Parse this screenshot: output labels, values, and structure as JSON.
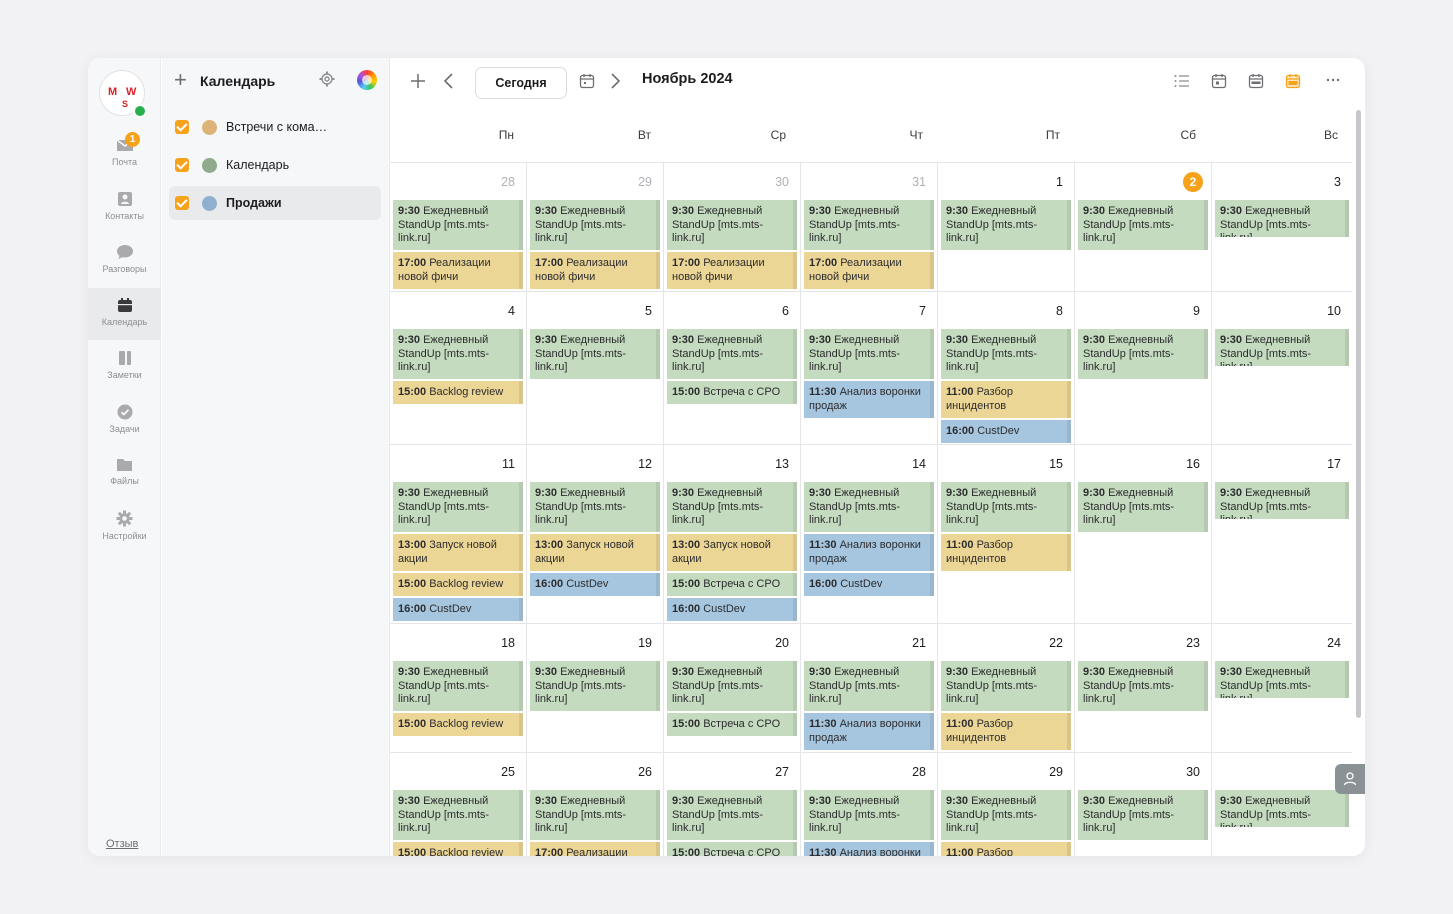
{
  "rail": {
    "avatar_letters": [
      "M",
      "W",
      "S"
    ],
    "mail_badge": "1",
    "items": [
      {
        "label": "Почта",
        "icon": "mail-icon"
      },
      {
        "label": "Контакты",
        "icon": "contacts-icon"
      },
      {
        "label": "Разговоры",
        "icon": "chat-icon"
      },
      {
        "label": "Календарь",
        "icon": "calendar-icon"
      },
      {
        "label": "Заметки",
        "icon": "notes-icon"
      },
      {
        "label": "Задачи",
        "icon": "tasks-icon"
      },
      {
        "label": "Файлы",
        "icon": "folder-icon"
      },
      {
        "label": "Настройки",
        "icon": "settings-icon"
      }
    ],
    "feedback": "Отзыв"
  },
  "panel": {
    "title": "Календарь",
    "calendars": [
      {
        "name": "Встречи с кома…",
        "color": "#dcb47a"
      },
      {
        "name": "Календарь",
        "color": "#8fab8c"
      },
      {
        "name": "Продажи",
        "color": "#8fb1cf"
      }
    ]
  },
  "toolbar": {
    "today_label": "Сегодня",
    "month_title": "Ноябрь 2024",
    "view_icons": [
      "list-view-icon",
      "day-view-icon",
      "week-view-icon",
      "month-view-icon",
      "more-icon"
    ]
  },
  "weekdays": [
    "Пн",
    "Вт",
    "Ср",
    "Чт",
    "Пт",
    "Сб",
    "Вс"
  ],
  "colors": {
    "accent": "#f7a21b",
    "green_event": "#c4dbbf",
    "yellow_event": "#ecd696",
    "blue_event": "#a6c6df"
  },
  "weeks": [
    {
      "days": [
        {
          "num": "28",
          "muted": true,
          "events": [
            [
              "9:30",
              "Ежедневный StandUp [mts.mts-link.ru]",
              "green"
            ],
            [
              "17:00",
              "Реализации новой фичи",
              "yellow"
            ]
          ]
        },
        {
          "num": "29",
          "muted": true,
          "events": [
            [
              "9:30",
              "Ежедневный StandUp [mts.mts-link.ru]",
              "green"
            ],
            [
              "17:00",
              "Реализации новой фичи",
              "yellow"
            ]
          ]
        },
        {
          "num": "30",
          "muted": true,
          "events": [
            [
              "9:30",
              "Ежедневный StandUp [mts.mts-link.ru]",
              "green"
            ],
            [
              "17:00",
              "Реализации новой фичи",
              "yellow"
            ]
          ]
        },
        {
          "num": "31",
          "muted": true,
          "events": [
            [
              "9:30",
              "Ежедневный StandUp [mts.mts-link.ru]",
              "green"
            ],
            [
              "17:00",
              "Реализации новой фичи",
              "yellow"
            ]
          ]
        },
        {
          "num": "1",
          "events": [
            [
              "9:30",
              "Ежедневный StandUp [mts.mts-link.ru]",
              "green"
            ]
          ]
        },
        {
          "num": "2",
          "today": true,
          "events": [
            [
              "9:30",
              "Ежедневный StandUp [mts.mts-link.ru]",
              "green"
            ]
          ]
        },
        {
          "num": "3",
          "events": [
            [
              "9:30",
              "Ежедневный StandUp [mts.mts-link.ru]",
              "green"
            ]
          ]
        }
      ]
    },
    {
      "days": [
        {
          "num": "4",
          "events": [
            [
              "9:30",
              "Ежедневный StandUp [mts.mts-link.ru]",
              "green"
            ],
            [
              "15:00",
              "Backlog review",
              "yellow"
            ]
          ]
        },
        {
          "num": "5",
          "events": [
            [
              "9:30",
              "Ежедневный StandUp [mts.mts-link.ru]",
              "green"
            ]
          ]
        },
        {
          "num": "6",
          "events": [
            [
              "9:30",
              "Ежедневный StandUp [mts.mts-link.ru]",
              "green"
            ],
            [
              "15:00",
              "Встреча с CPO",
              "green"
            ]
          ]
        },
        {
          "num": "7",
          "events": [
            [
              "9:30",
              "Ежедневный StandUp [mts.mts-link.ru]",
              "green"
            ],
            [
              "11:30",
              "Анализ воронки продаж",
              "blue"
            ]
          ]
        },
        {
          "num": "8",
          "events": [
            [
              "9:30",
              "Ежедневный StandUp [mts.mts-link.ru]",
              "green"
            ],
            [
              "11:00",
              "Разбор инцидентов",
              "yellow"
            ],
            [
              "16:00",
              "CustDev",
              "blue"
            ]
          ]
        },
        {
          "num": "9",
          "events": [
            [
              "9:30",
              "Ежедневный StandUp [mts.mts-link.ru]",
              "green"
            ]
          ]
        },
        {
          "num": "10",
          "events": [
            [
              "9:30",
              "Ежедневный StandUp [mts.mts-link.ru]",
              "green"
            ]
          ]
        }
      ]
    },
    {
      "days": [
        {
          "num": "11",
          "events": [
            [
              "9:30",
              "Ежедневный StandUp [mts.mts-link.ru]",
              "green"
            ],
            [
              "13:00",
              "Запуск новой акции",
              "yellow"
            ],
            [
              "15:00",
              "Backlog review",
              "yellow"
            ],
            [
              "16:00",
              "CustDev",
              "blue"
            ]
          ]
        },
        {
          "num": "12",
          "events": [
            [
              "9:30",
              "Ежедневный StandUp [mts.mts-link.ru]",
              "green"
            ],
            [
              "13:00",
              "Запуск новой акции",
              "yellow"
            ],
            [
              "16:00",
              "CustDev",
              "blue"
            ]
          ]
        },
        {
          "num": "13",
          "events": [
            [
              "9:30",
              "Ежедневный StandUp [mts.mts-link.ru]",
              "green"
            ],
            [
              "13:00",
              "Запуск новой акции",
              "yellow"
            ],
            [
              "15:00",
              "Встреча с CPO",
              "green"
            ],
            [
              "16:00",
              "CustDev",
              "blue"
            ]
          ]
        },
        {
          "num": "14",
          "events": [
            [
              "9:30",
              "Ежедневный StandUp [mts.mts-link.ru]",
              "green"
            ],
            [
              "11:30",
              "Анализ воронки продаж",
              "blue"
            ],
            [
              "16:00",
              "CustDev",
              "blue"
            ]
          ]
        },
        {
          "num": "15",
          "events": [
            [
              "9:30",
              "Ежедневный StandUp [mts.mts-link.ru]",
              "green"
            ],
            [
              "11:00",
              "Разбор инцидентов",
              "yellow"
            ]
          ]
        },
        {
          "num": "16",
          "events": [
            [
              "9:30",
              "Ежедневный StandUp [mts.mts-link.ru]",
              "green"
            ]
          ]
        },
        {
          "num": "17",
          "events": [
            [
              "9:30",
              "Ежедневный StandUp [mts.mts-link.ru]",
              "green"
            ]
          ]
        }
      ]
    },
    {
      "days": [
        {
          "num": "18",
          "events": [
            [
              "9:30",
              "Ежедневный StandUp [mts.mts-link.ru]",
              "green"
            ],
            [
              "15:00",
              "Backlog review",
              "yellow"
            ]
          ]
        },
        {
          "num": "19",
          "events": [
            [
              "9:30",
              "Ежедневный StandUp [mts.mts-link.ru]",
              "green"
            ]
          ]
        },
        {
          "num": "20",
          "events": [
            [
              "9:30",
              "Ежедневный StandUp [mts.mts-link.ru]",
              "green"
            ],
            [
              "15:00",
              "Встреча с CPO",
              "green"
            ]
          ]
        },
        {
          "num": "21",
          "events": [
            [
              "9:30",
              "Ежедневный StandUp [mts.mts-link.ru]",
              "green"
            ],
            [
              "11:30",
              "Анализ воронки продаж",
              "blue"
            ]
          ]
        },
        {
          "num": "22",
          "events": [
            [
              "9:30",
              "Ежедневный StandUp [mts.mts-link.ru]",
              "green"
            ],
            [
              "11:00",
              "Разбор инцидентов",
              "yellow"
            ]
          ]
        },
        {
          "num": "23",
          "events": [
            [
              "9:30",
              "Ежедневный StandUp [mts.mts-link.ru]",
              "green"
            ]
          ]
        },
        {
          "num": "24",
          "events": [
            [
              "9:30",
              "Ежедневный StandUp [mts.mts-link.ru]",
              "green"
            ]
          ]
        }
      ]
    },
    {
      "days": [
        {
          "num": "25",
          "events": [
            [
              "9:30",
              "Ежедневный StandUp [mts.mts-link.ru]",
              "green"
            ],
            [
              "15:00",
              "Backlog review",
              "yellow"
            ]
          ]
        },
        {
          "num": "26",
          "events": [
            [
              "9:30",
              "Ежедневный StandUp [mts.mts-link.ru]",
              "green"
            ],
            [
              "17:00",
              "Реализации",
              "yellow"
            ]
          ]
        },
        {
          "num": "27",
          "events": [
            [
              "9:30",
              "Ежедневный StandUp [mts.mts-link.ru]",
              "green"
            ],
            [
              "15:00",
              "Встреча с CPO",
              "green"
            ]
          ]
        },
        {
          "num": "28",
          "events": [
            [
              "9:30",
              "Ежедневный StandUp [mts.mts-link.ru]",
              "green"
            ],
            [
              "11:30",
              "Анализ воронки",
              "blue"
            ]
          ]
        },
        {
          "num": "29",
          "events": [
            [
              "9:30",
              "Ежедневный StandUp [mts.mts-link.ru]",
              "green"
            ],
            [
              "11:00",
              "Разбор",
              "yellow"
            ]
          ]
        },
        {
          "num": "30",
          "events": [
            [
              "9:30",
              "Ежедневный StandUp [mts.mts-link.ru]",
              "green"
            ]
          ]
        },
        {
          "num": "",
          "events": [
            [
              "9:30",
              "Ежедневный StandUp [mts.mts-link.ru]",
              "green"
            ]
          ]
        }
      ]
    }
  ]
}
